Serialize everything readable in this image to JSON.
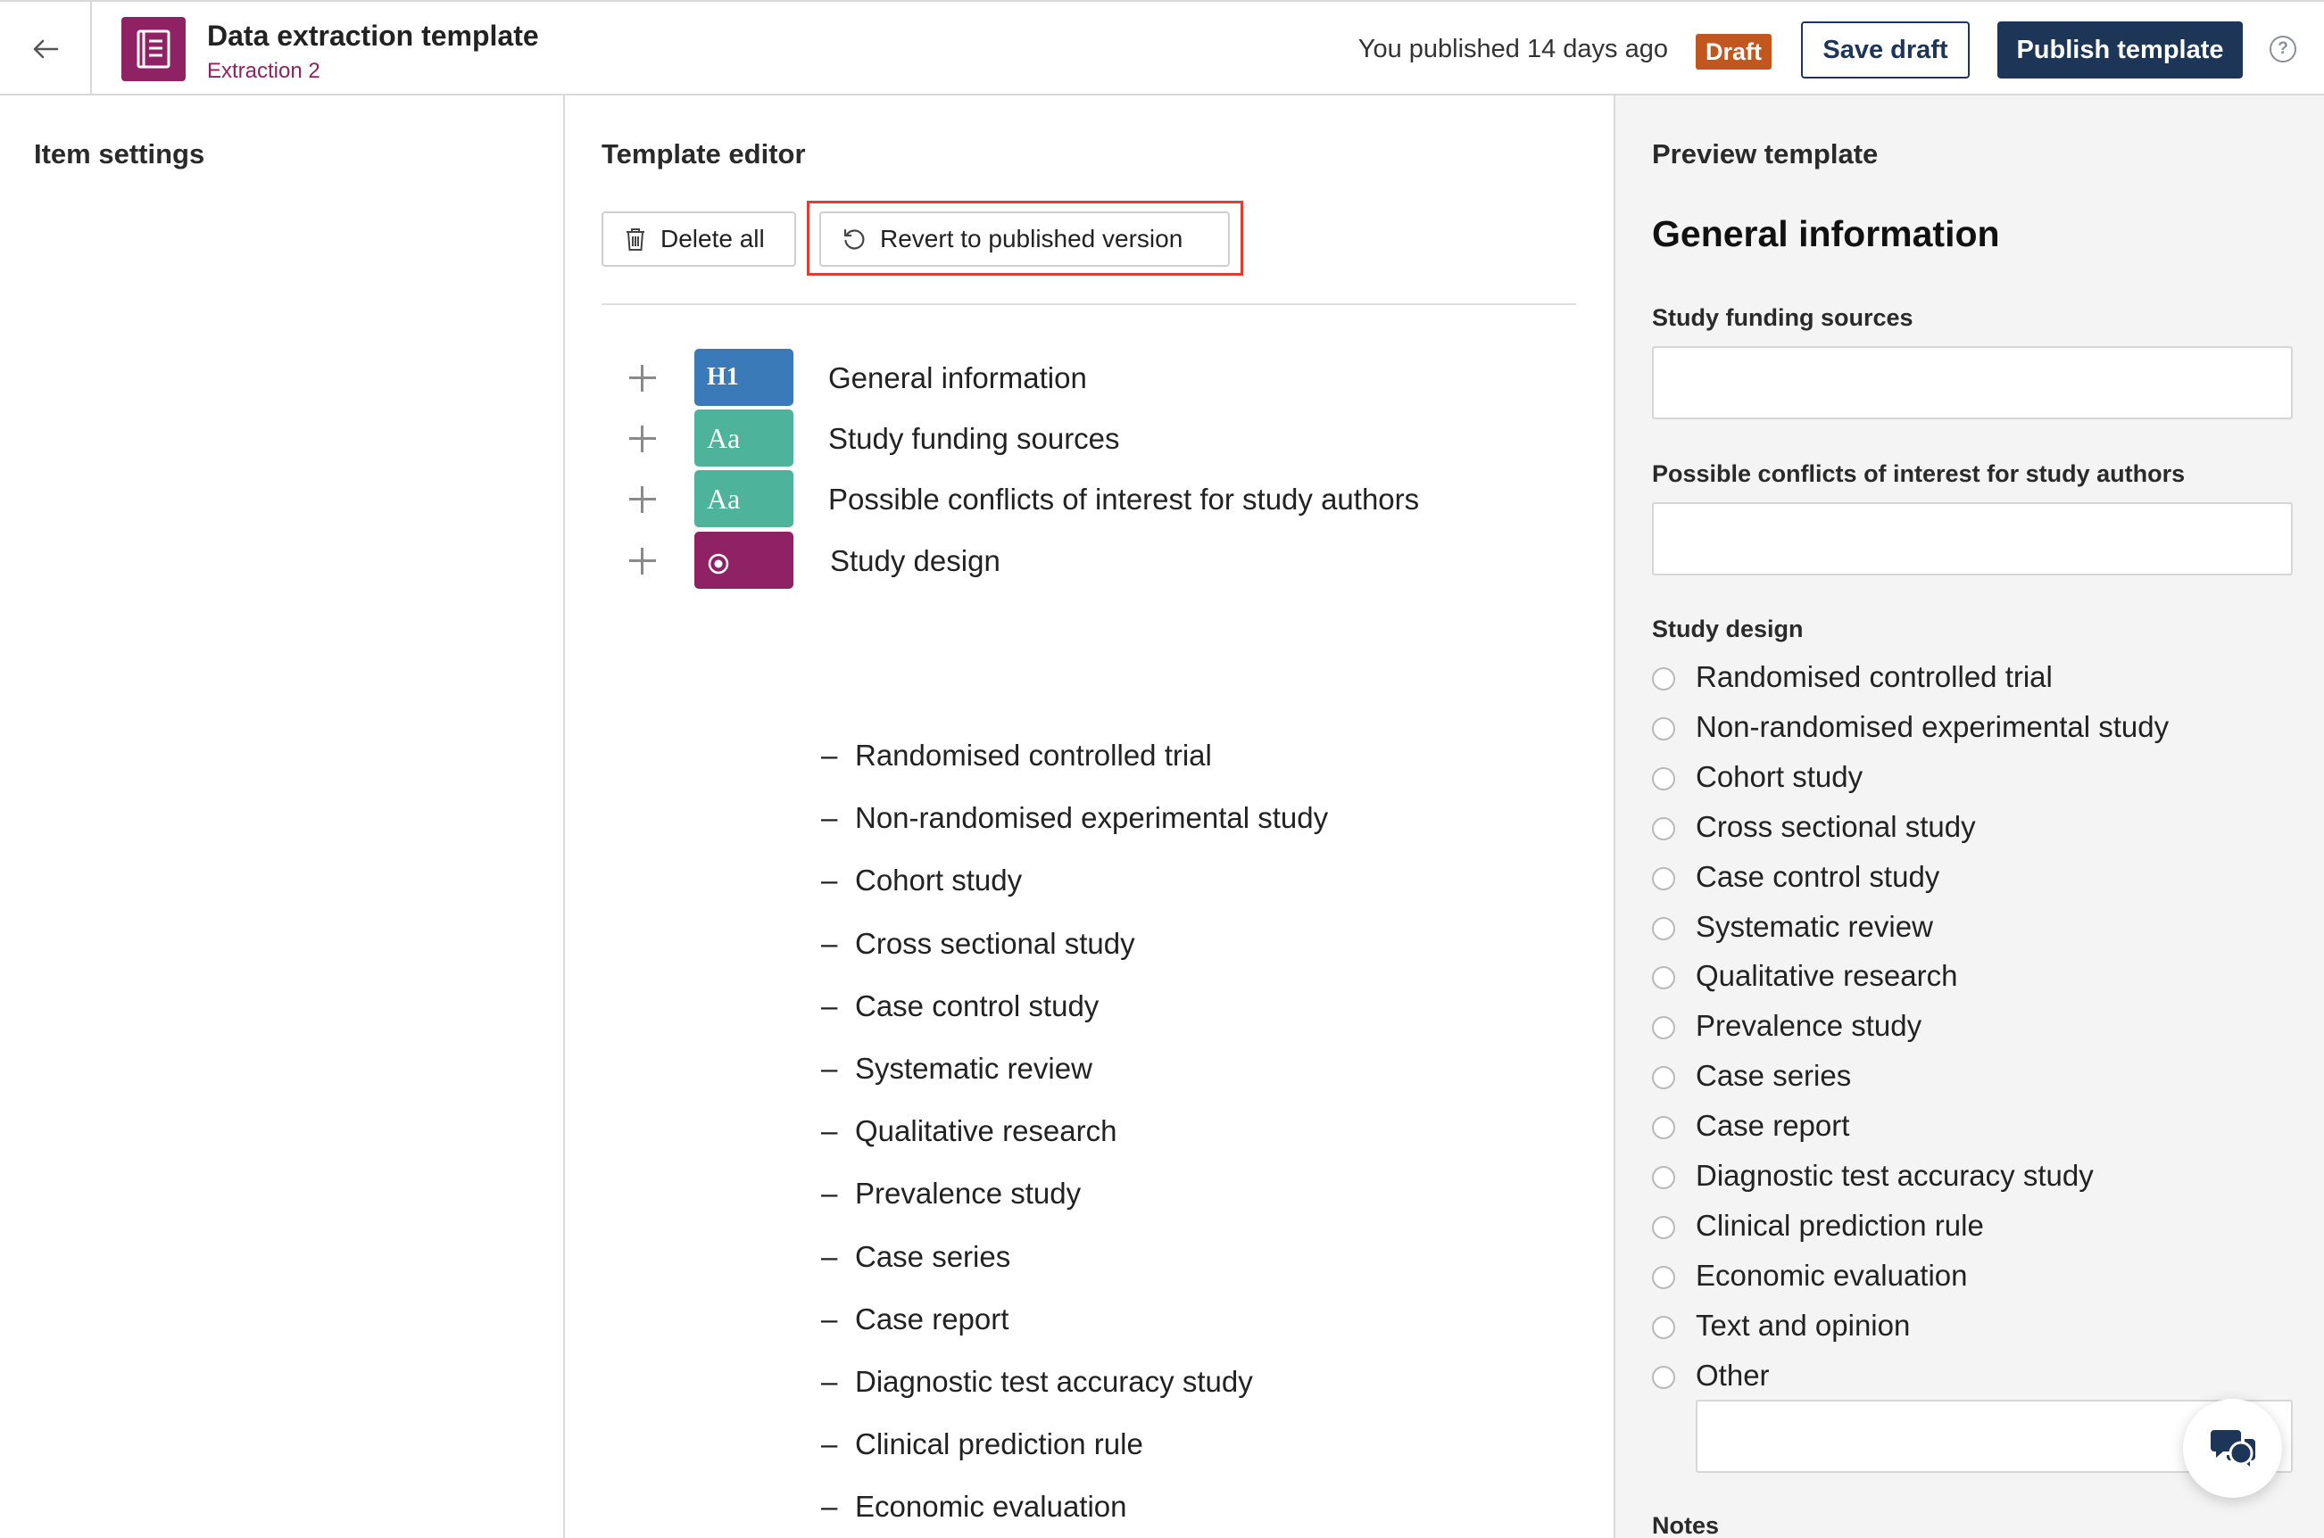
{
  "header": {
    "title": "Data extraction template",
    "subtitle": "Extraction 2",
    "published_text": "You published 14 days ago",
    "draft_badge": "Draft",
    "save_draft_label": "Save draft",
    "publish_label": "Publish template",
    "help_glyph": "?"
  },
  "left_panel": {
    "heading": "Item settings"
  },
  "editor": {
    "heading": "Template editor",
    "delete_all_label": "Delete all",
    "revert_label": "Revert to published version",
    "items": [
      {
        "type": "heading",
        "chip": "H1",
        "label": "General information"
      },
      {
        "type": "text",
        "chip": "Aa",
        "label": "Study funding sources"
      },
      {
        "type": "text",
        "chip": "Aa",
        "label": "Possible conflicts of interest for study authors"
      },
      {
        "type": "radio",
        "chip": "",
        "label": "Study design"
      }
    ],
    "study_design_options": [
      "Randomised controlled trial",
      "Non-randomised experimental study",
      "Cohort study",
      "Cross sectional study",
      "Case control study",
      "Systematic review",
      "Qualitative research",
      "Prevalence study",
      "Case series",
      "Case report",
      "Diagnostic test accuracy study",
      "Clinical prediction rule",
      "Economic evaluation"
    ],
    "option_bullet": "–"
  },
  "preview": {
    "heading": "Preview template",
    "section_title": "General information",
    "field_funding": "Study funding sources",
    "field_conflicts": "Possible conflicts of interest for study authors",
    "field_design": "Study design",
    "design_options": [
      "Randomised controlled trial",
      "Non-randomised experimental study",
      "Cohort study",
      "Cross sectional study",
      "Case control study",
      "Systematic review",
      "Qualitative research",
      "Prevalence study",
      "Case series",
      "Case report",
      "Diagnostic test accuracy study",
      "Clinical prediction rule",
      "Economic evaluation",
      "Text and opinion",
      "Other"
    ],
    "notes_label": "Notes"
  },
  "colors": {
    "brand": "#8e2265",
    "primary": "#1d3557",
    "draft": "#c1561e",
    "chip_heading": "#3a7ab8",
    "chip_text": "#4db39b",
    "highlight": "#e03c31"
  }
}
